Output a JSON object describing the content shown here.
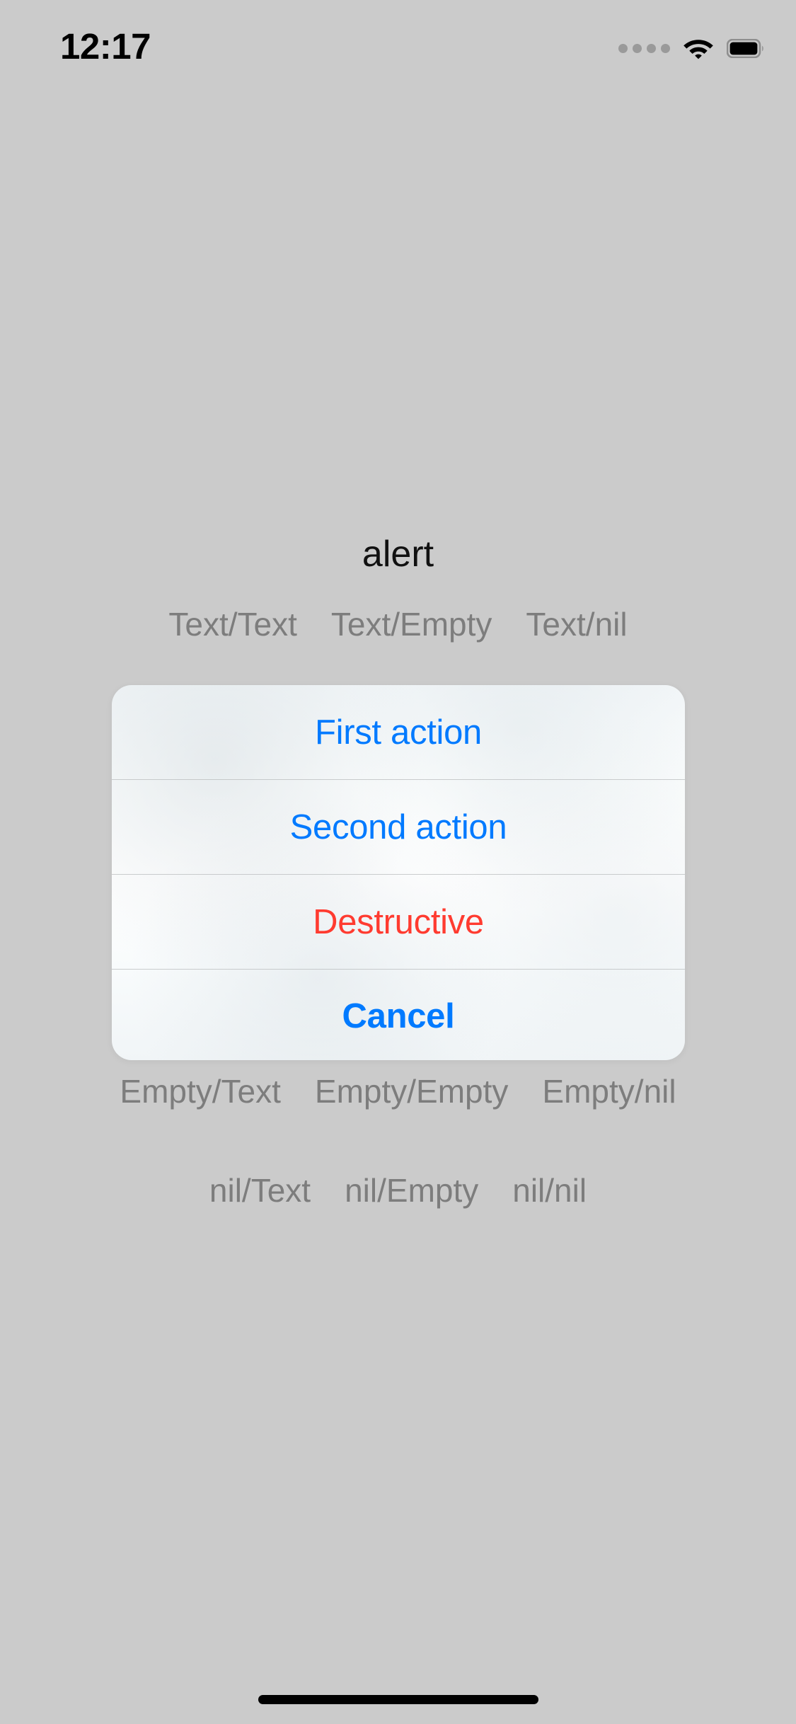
{
  "status_bar": {
    "time": "12:17",
    "cellular_icon": "cellular-dots-icon",
    "cellular_bars": 4,
    "wifi_icon": "wifi-icon",
    "battery_icon": "battery-full-icon"
  },
  "page": {
    "title": "alert"
  },
  "rows": {
    "text_row": [
      {
        "label": "Text/Text"
      },
      {
        "label": "Text/Empty"
      },
      {
        "label": "Text/nil"
      }
    ],
    "empty_row": [
      {
        "label": "Empty/Text"
      },
      {
        "label": "Empty/Empty"
      },
      {
        "label": "Empty/nil"
      }
    ],
    "nil_row": [
      {
        "label": "nil/Text"
      },
      {
        "label": "nil/Empty"
      },
      {
        "label": "nil/nil"
      }
    ]
  },
  "action_sheet": {
    "actions": [
      {
        "label": "First action",
        "style": "default"
      },
      {
        "label": "Second action",
        "style": "default"
      },
      {
        "label": "Destructive",
        "style": "destructive"
      },
      {
        "label": "Cancel",
        "style": "cancel"
      }
    ]
  },
  "colors": {
    "background": "#cbcbcb",
    "accent_blue": "#007aff",
    "destructive_red": "#ff3b30",
    "row_label_gray": "#7d7d7d",
    "title_black": "#111111",
    "sheet_divider": "#b9bcbe"
  },
  "home_indicator": {
    "name": "home-indicator"
  }
}
